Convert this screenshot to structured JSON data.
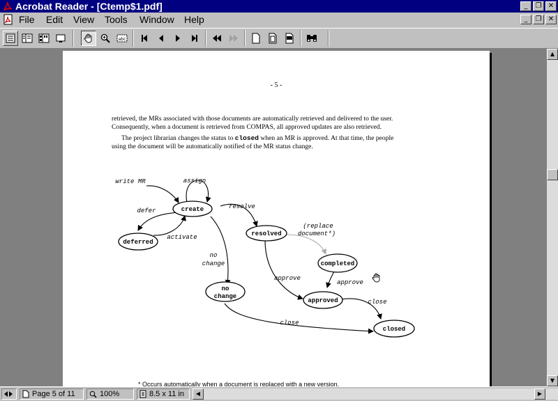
{
  "window": {
    "title": "Acrobat Reader - [Ctemp$1.pdf]",
    "controls": {
      "minimize": "_",
      "restore": "❐",
      "close": "✕"
    }
  },
  "menu": [
    "File",
    "Edit",
    "View",
    "Tools",
    "Window",
    "Help"
  ],
  "page": {
    "page_number": "- 5 -",
    "para1": [
      "retrieved, the MRs associated with those documents are automatically retrieved and delivered to the user.",
      "Consequently, when a document is retrieved from",
      "COMPAS",
      ", all approved updates are also retrieved."
    ],
    "para2": [
      "The project librarian changes the status to",
      "closed",
      "when an MR is approved.  At that time, the people",
      "using the document will be automatically notified of the MR status change."
    ],
    "diagram": {
      "states": [
        "create",
        "deferred",
        "resolved",
        "completed",
        "no",
        "change",
        "approved",
        "closed"
      ],
      "edge_labels": [
        "write MR",
        "assign",
        "defer",
        "activate",
        "resolve",
        "(replace",
        "document*)",
        "no",
        "change",
        "approve",
        "approve",
        "close",
        "close"
      ]
    },
    "footnote": "* Occurs automatically when a document is replaced with a new version."
  },
  "status": {
    "page": "Page 5 of 11",
    "zoom": "100%",
    "size": "8.5 x 11 in"
  }
}
